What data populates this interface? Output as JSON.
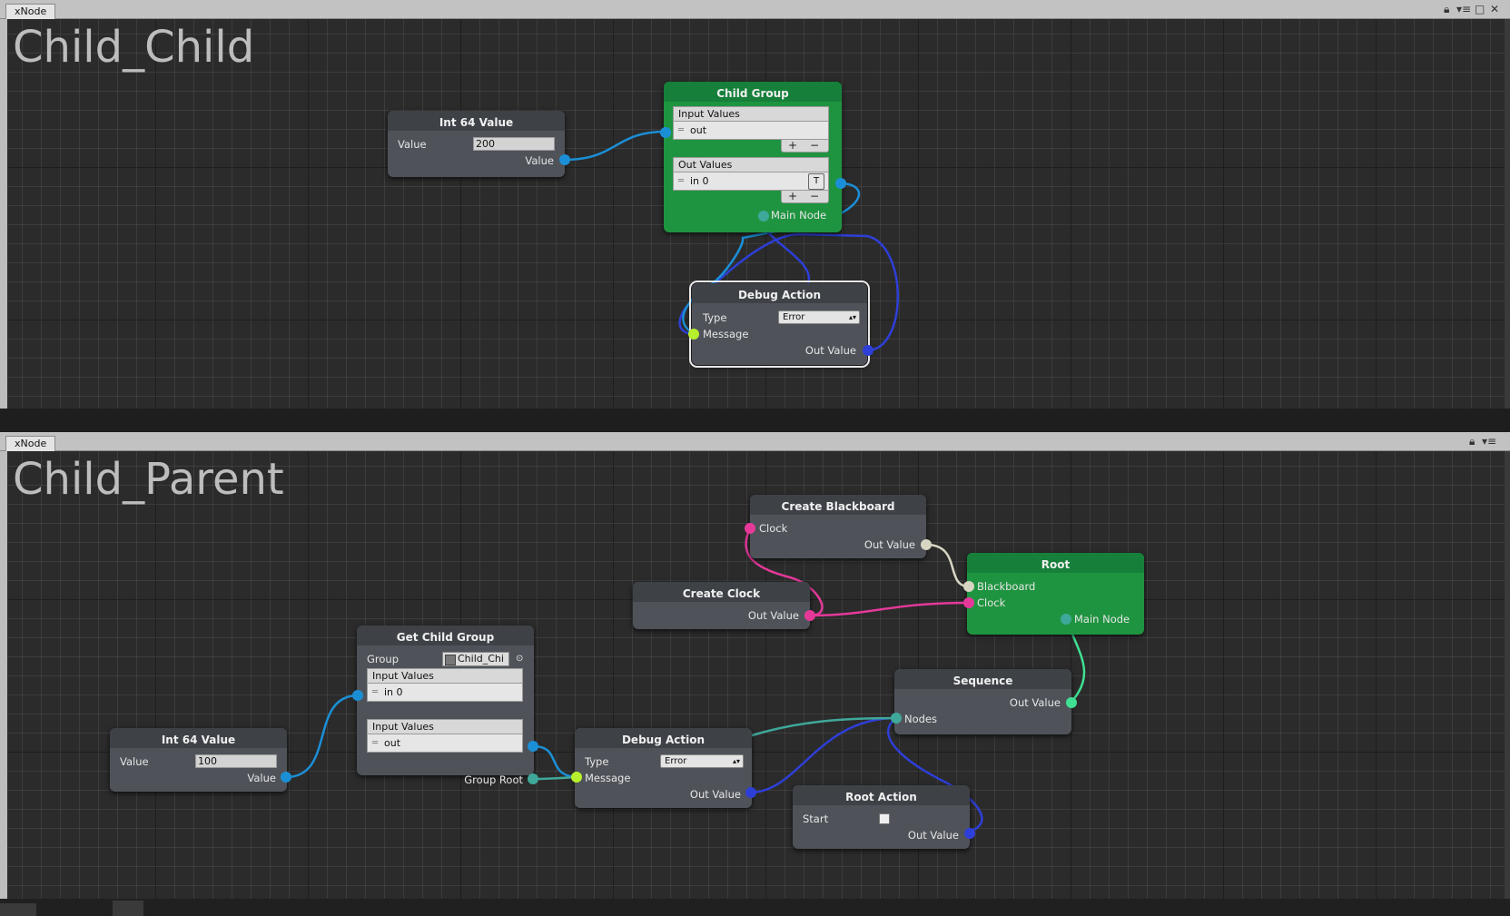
{
  "colors": {
    "port_int64": "#1b8fd6",
    "port_string": "#b6f02c",
    "port_action": "#2e3fd8",
    "port_node": "#3fa89a",
    "port_clock": "#e5399a",
    "port_blackboard": "#d8d6c3",
    "port_sequence_out": "#3fe093",
    "node_green": "#1f9440",
    "node_grey": "#4f5359"
  },
  "top_panel": {
    "tab": "xNode",
    "window_icons": [
      "lock-icon",
      "menu-icon",
      "maximize-icon",
      "close-icon"
    ],
    "graph_title": "Child_Child",
    "int64": {
      "title": "Int 64 Value",
      "value_label": "Value",
      "value": "200",
      "out_label": "Value"
    },
    "child_group": {
      "title": "Child Group",
      "input_header": "Input Values",
      "input_item": "out",
      "out_header": "Out Values",
      "out_item": "in 0",
      "t_label": "T",
      "plus": "+",
      "minus": "−",
      "main_node": "Main Node"
    },
    "debug_action": {
      "title": "Debug Action",
      "type_label": "Type",
      "type_value": "Error",
      "message": "Message",
      "out_value": "Out Value"
    }
  },
  "bottom_panel": {
    "tab": "xNode",
    "window_icons": [
      "lock-icon",
      "menu-icon"
    ],
    "graph_title": "Child_Parent",
    "create_blackboard": {
      "title": "Create Blackboard",
      "clock": "Clock",
      "out_value": "Out Value"
    },
    "create_clock": {
      "title": "Create Clock",
      "out_value": "Out Value"
    },
    "root": {
      "title": "Root",
      "blackboard": "Blackboard",
      "clock": "Clock",
      "main_node": "Main Node"
    },
    "sequence": {
      "title": "Sequence",
      "out_value": "Out Value",
      "nodes": "Nodes"
    },
    "get_child_group": {
      "title": "Get Child Group",
      "group_label": "Group",
      "group_value": "Child_Chi",
      "input1_header": "Input Values",
      "input1_item": "in 0",
      "input2_header": "Input Values",
      "input2_item": "out",
      "group_root": "Group Root"
    },
    "int64": {
      "title": "Int 64 Value",
      "value_label": "Value",
      "value": "100",
      "out_label": "Value"
    },
    "debug_action": {
      "title": "Debug Action",
      "type_label": "Type",
      "type_value": "Error",
      "message": "Message",
      "out_value": "Out Value"
    },
    "root_action": {
      "title": "Root Action",
      "start": "Start",
      "start_checked": false,
      "out_value": "Out Value"
    }
  }
}
